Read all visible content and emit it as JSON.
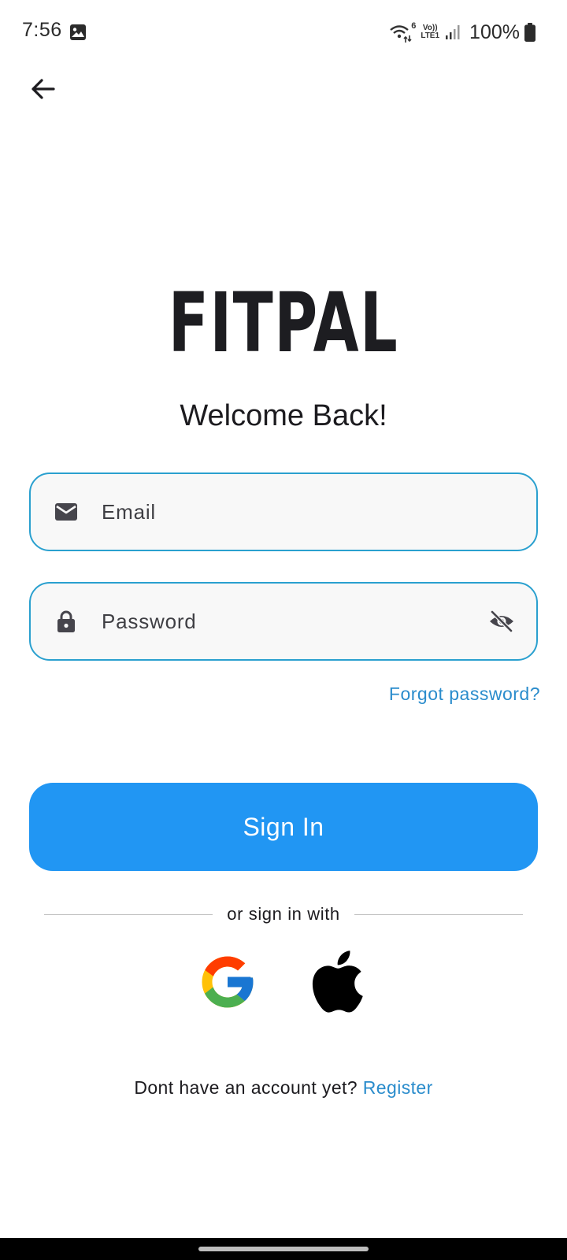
{
  "status_bar": {
    "time": "7:56",
    "network_top": "Vo))",
    "network_bottom": "LTE1",
    "wifi_badge": "6",
    "battery": "100%"
  },
  "header": {
    "back_icon": "arrow-left-icon"
  },
  "logo": "FITPAL",
  "welcome": "Welcome Back!",
  "email_field": {
    "placeholder": "Email",
    "icon": "mail-icon"
  },
  "password_field": {
    "placeholder": "Password",
    "icon": "lock-icon",
    "toggle_icon": "eye-off-icon"
  },
  "forgot_password": "Forgot password?",
  "sign_in_button": "Sign In",
  "divider_text": "or sign in with",
  "social": [
    "google-icon",
    "apple-icon"
  ],
  "register": {
    "prompt": "Dont have an account yet?",
    "link": "Register"
  },
  "colors": {
    "primary": "#2196f3",
    "link": "#2a8ccc",
    "field_border": "#2aa0cf",
    "field_bg": "#f8f8f8"
  }
}
